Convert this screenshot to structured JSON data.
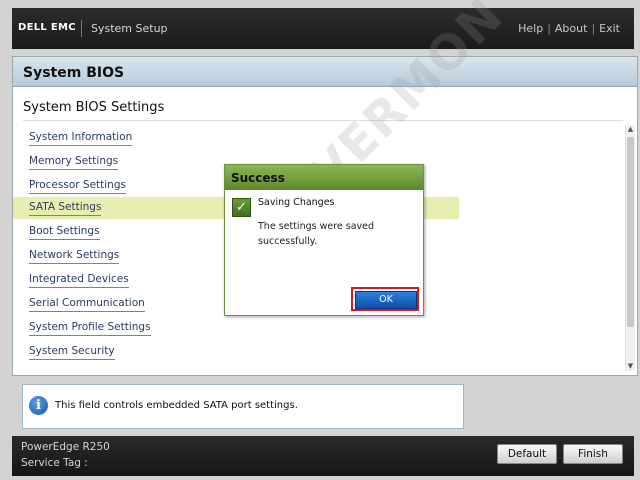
{
  "header": {
    "logo_text": "DELL EMC",
    "app_title": "System Setup",
    "help": "Help",
    "about": "About",
    "exit": "Exit",
    "separator": "|"
  },
  "panel": {
    "title": "System BIOS",
    "subtitle": "System BIOS Settings",
    "items": [
      {
        "label": "System Information"
      },
      {
        "label": "Memory Settings"
      },
      {
        "label": "Processor Settings"
      },
      {
        "label": "SATA Settings",
        "selected": true
      },
      {
        "label": "Boot Settings"
      },
      {
        "label": "Network Settings"
      },
      {
        "label": "Integrated Devices"
      },
      {
        "label": "Serial Communication"
      },
      {
        "label": "System Profile Settings"
      },
      {
        "label": "System Security"
      }
    ]
  },
  "info": {
    "icon": "info-icon",
    "text": "This field controls embedded SATA port settings."
  },
  "footer": {
    "model": "PowerEdge R250",
    "service_tag_label": "Service Tag :",
    "default_button": "Default",
    "finish_button": "Finish"
  },
  "dialog": {
    "title": "Success",
    "icon": "checkmark-icon",
    "heading": "Saving Changes",
    "message": "The settings were saved successfully.",
    "ok_button": "OK",
    "highlight_color": "#d01a20"
  },
  "watermark": {
    "text": "SERVERMON"
  },
  "colors": {
    "dialog_header": "#6f9c3a",
    "selected_row": "#e8edb0",
    "ok_button": "#1a62c4"
  }
}
